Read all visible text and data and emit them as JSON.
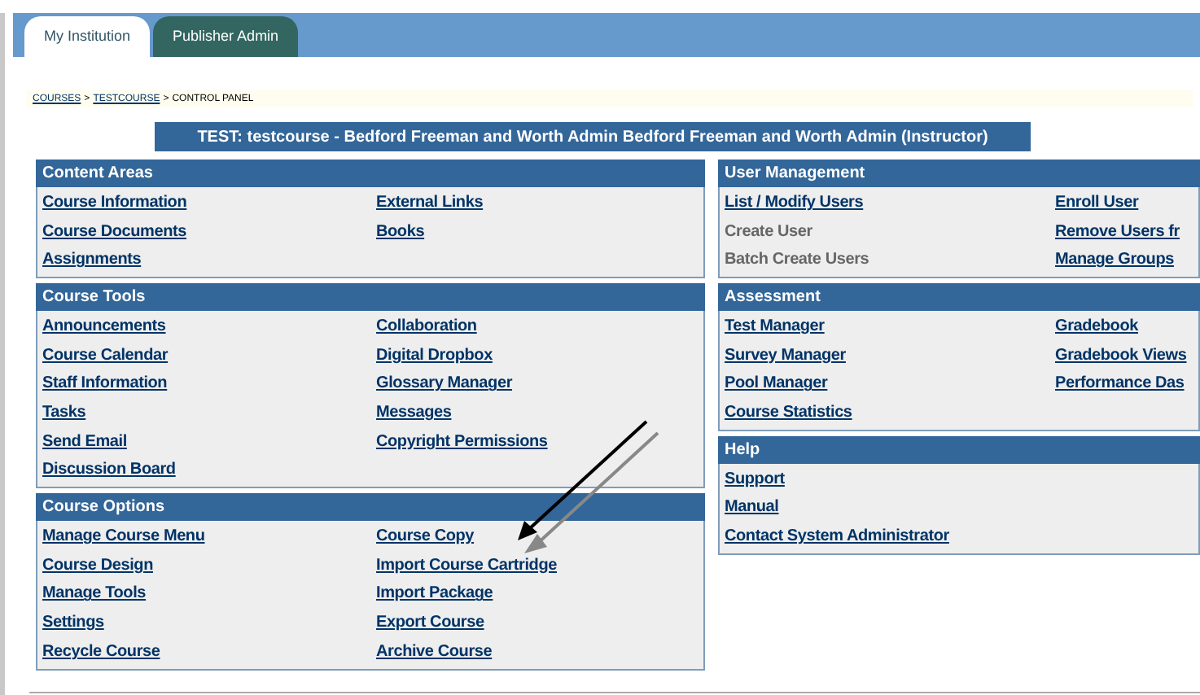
{
  "tabs": [
    {
      "label": "My Institution",
      "selected": true
    },
    {
      "label": "Publisher Admin",
      "selected": false
    }
  ],
  "breadcrumb": [
    {
      "label": "COURSES",
      "link": true
    },
    {
      "label": ">",
      "link": false
    },
    {
      "label": "TESTCOURSE",
      "link": true
    },
    {
      "label": ">",
      "link": false
    },
    {
      "label": "CONTROL PANEL",
      "link": false
    }
  ],
  "course_title": "TEST: testcourse - Bedford Freeman and Worth Admin Bedford Freeman and Worth Admin (Instructor)",
  "left_panels": [
    {
      "title": "Content Areas",
      "columns": [
        [
          {
            "label": "Course Information",
            "disabled": false
          },
          {
            "label": "Course Documents",
            "disabled": false
          },
          {
            "label": "Assignments",
            "disabled": false
          }
        ],
        [
          {
            "label": "External Links",
            "disabled": false
          },
          {
            "label": "Books",
            "disabled": false
          }
        ]
      ]
    },
    {
      "title": "Course Tools",
      "columns": [
        [
          {
            "label": "Announcements",
            "disabled": false
          },
          {
            "label": "Course Calendar",
            "disabled": false
          },
          {
            "label": "Staff Information",
            "disabled": false
          },
          {
            "label": "Tasks",
            "disabled": false
          },
          {
            "label": "Send Email",
            "disabled": false
          },
          {
            "label": "Discussion Board",
            "disabled": false
          }
        ],
        [
          {
            "label": "Collaboration",
            "disabled": false
          },
          {
            "label": "Digital Dropbox",
            "disabled": false
          },
          {
            "label": "Glossary Manager",
            "disabled": false
          },
          {
            "label": "Messages",
            "disabled": false
          },
          {
            "label": "Copyright Permissions",
            "disabled": false
          }
        ]
      ]
    },
    {
      "title": "Course Options",
      "columns": [
        [
          {
            "label": "Manage Course Menu",
            "disabled": false
          },
          {
            "label": "Course Design",
            "disabled": false
          },
          {
            "label": "Manage Tools",
            "disabled": false
          },
          {
            "label": "Settings",
            "disabled": false
          },
          {
            "label": "Recycle Course",
            "disabled": false
          }
        ],
        [
          {
            "label": "Course Copy",
            "disabled": false
          },
          {
            "label": "Import Course Cartridge",
            "disabled": false
          },
          {
            "label": "Import Package",
            "disabled": false
          },
          {
            "label": "Export Course",
            "disabled": false
          },
          {
            "label": "Archive Course",
            "disabled": false
          }
        ]
      ]
    }
  ],
  "right_panels": [
    {
      "title": "User Management",
      "columns": [
        [
          {
            "label": "List / Modify Users",
            "disabled": false
          },
          {
            "label": "Create User",
            "disabled": true
          },
          {
            "label": "Batch Create Users",
            "disabled": true
          }
        ],
        [
          {
            "label": "Enroll User",
            "disabled": false
          },
          {
            "label": "Remove Users fr",
            "disabled": false
          },
          {
            "label": "Manage Groups",
            "disabled": false
          }
        ]
      ]
    },
    {
      "title": "Assessment",
      "columns": [
        [
          {
            "label": "Test Manager",
            "disabled": false
          },
          {
            "label": "Survey Manager",
            "disabled": false
          },
          {
            "label": "Pool Manager",
            "disabled": false
          },
          {
            "label": "Course Statistics",
            "disabled": false
          }
        ],
        [
          {
            "label": "Gradebook",
            "disabled": false
          },
          {
            "label": "Gradebook Views",
            "disabled": false
          },
          {
            "label": "Performance Das",
            "disabled": false
          }
        ]
      ]
    },
    {
      "title": "Help",
      "columns": [
        [
          {
            "label": "Support",
            "disabled": false
          },
          {
            "label": "Manual",
            "disabled": false
          },
          {
            "label": "Contact System Administrator",
            "disabled": false
          }
        ]
      ]
    }
  ]
}
